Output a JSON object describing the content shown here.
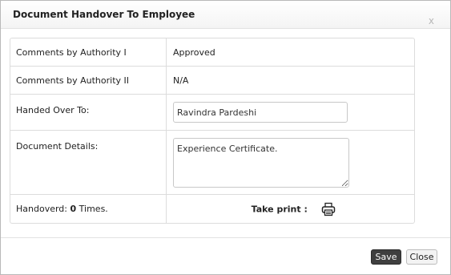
{
  "dialog": {
    "title": "Document Handover To Employee",
    "close_glyph": "x"
  },
  "form": {
    "authority1_label": "Comments by Authority I",
    "authority1_value": "Approved",
    "authority2_label": "Comments by Authority II",
    "authority2_value": "N/A",
    "handed_over_label": "Handed Over To:",
    "handed_over_value": "Ravindra Pardeshi",
    "document_details_label": "Document Details:",
    "document_details_value": "Experience Certificate.",
    "handover_prefix": "Handoverd:",
    "handover_count": "0",
    "handover_suffix": "Times.",
    "take_print_label": "Take print :"
  },
  "footer": {
    "save_label": "Save",
    "close_label": "Close"
  },
  "icons": {
    "printer": "printer-icon",
    "close": "close-icon"
  },
  "colors": {
    "save_button_bg": "#3f3f3f",
    "border": "#dcdcdc"
  }
}
